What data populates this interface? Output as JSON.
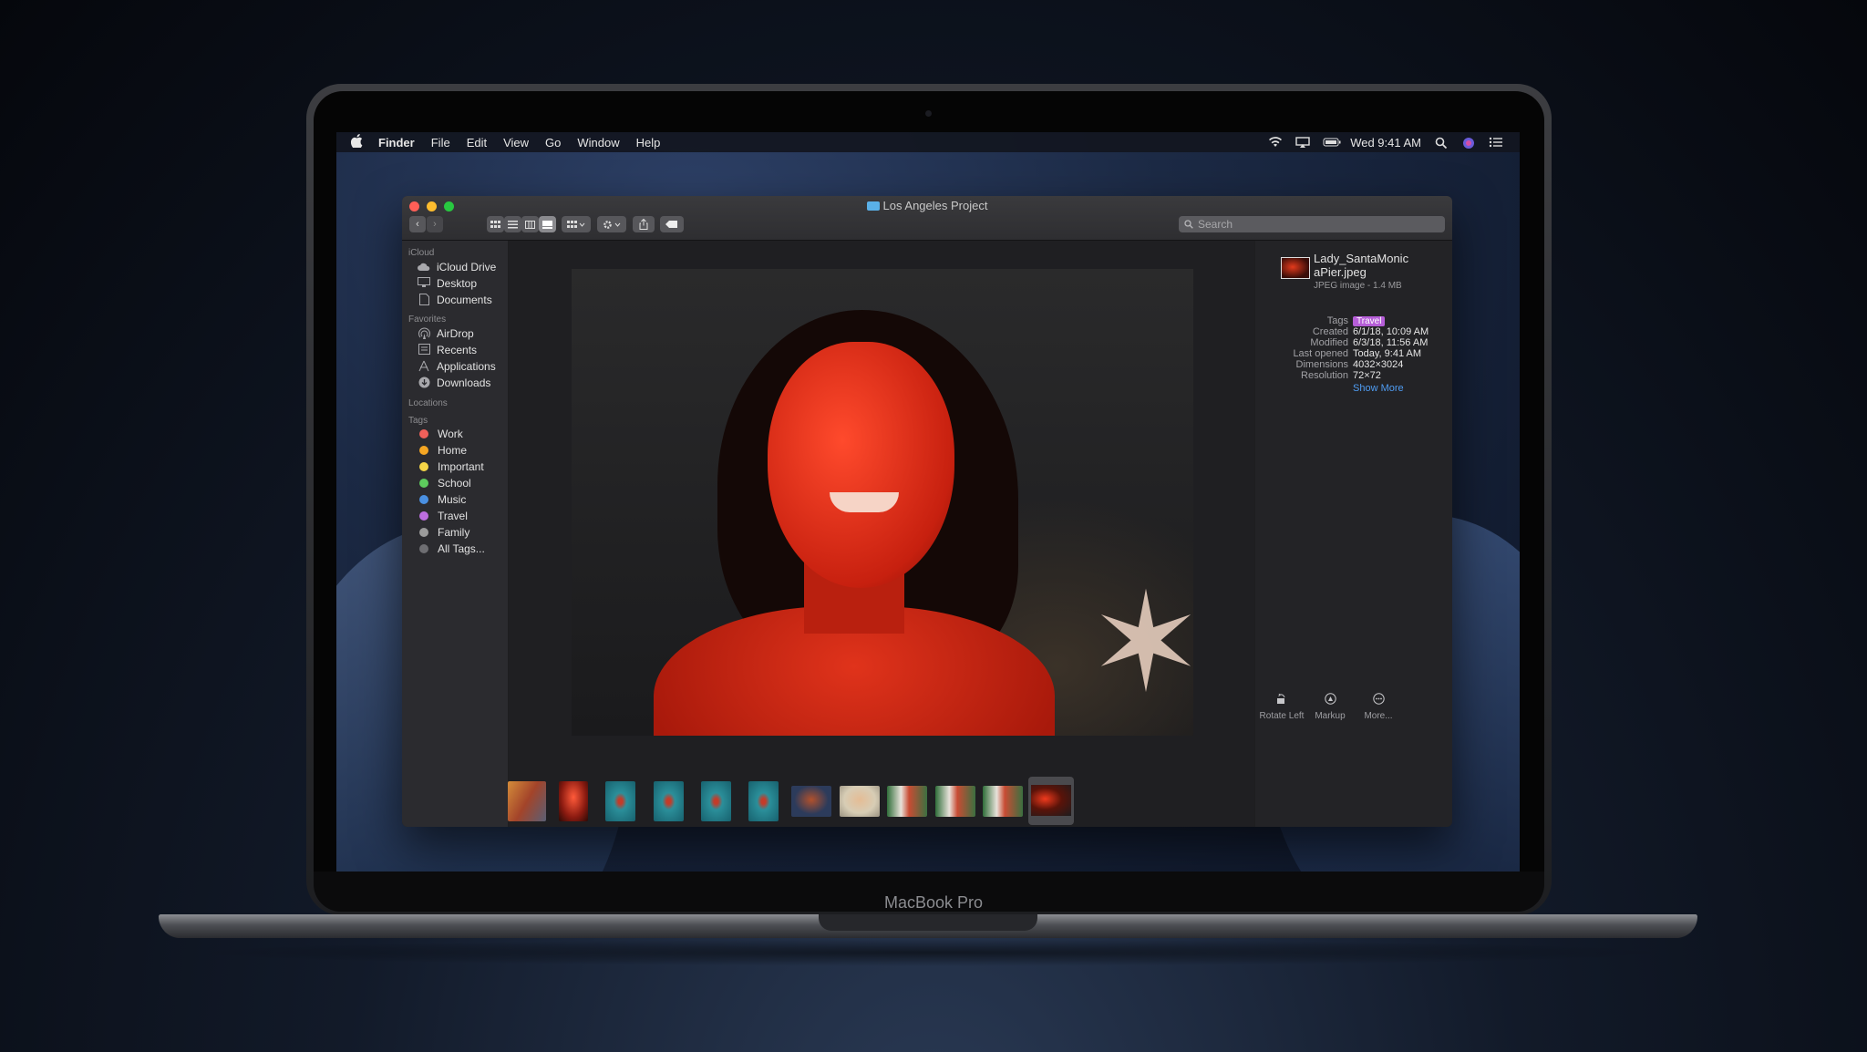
{
  "laptop": {
    "label": "MacBook Pro"
  },
  "menubar": {
    "app": "Finder",
    "items": [
      "File",
      "Edit",
      "View",
      "Go",
      "Window",
      "Help"
    ],
    "clock": "Wed 9:41 AM",
    "icons": [
      "apple-icon",
      "wifi-icon",
      "airplay-icon",
      "battery-icon",
      "spotlight-icon",
      "siri-icon",
      "notification-center-icon"
    ]
  },
  "window": {
    "title": "Los Angeles Project",
    "search_placeholder": "Search",
    "traffic_light_colors": [
      "#fe5f57",
      "#febc2e",
      "#28c840"
    ]
  },
  "sidebar": {
    "sections": [
      {
        "title": "iCloud",
        "items": [
          {
            "label": "iCloud Drive",
            "icon": "cloud-icon"
          },
          {
            "label": "Desktop",
            "icon": "desktop-icon"
          },
          {
            "label": "Documents",
            "icon": "document-icon"
          }
        ]
      },
      {
        "title": "Favorites",
        "items": [
          {
            "label": "AirDrop",
            "icon": "airdrop-icon"
          },
          {
            "label": "Recents",
            "icon": "clock-icon"
          },
          {
            "label": "Applications",
            "icon": "applications-icon"
          },
          {
            "label": "Downloads",
            "icon": "download-icon"
          }
        ]
      },
      {
        "title": "Locations",
        "items": []
      },
      {
        "title": "Tags",
        "items": [
          {
            "label": "Work",
            "color": "#f0605a"
          },
          {
            "label": "Home",
            "color": "#f5a623"
          },
          {
            "label": "Important",
            "color": "#f5d547"
          },
          {
            "label": "School",
            "color": "#5dcb5d"
          },
          {
            "label": "Music",
            "color": "#4a90e2"
          },
          {
            "label": "Travel",
            "color": "#bd6ee0"
          },
          {
            "label": "Family",
            "color": "#9b9b9b"
          },
          {
            "label": "All Tags...",
            "color": "#6e6e72"
          }
        ]
      }
    ]
  },
  "inspector": {
    "file_name": "Lady_SantaMonicaPier.jpeg",
    "file_name_line1": "Lady_SantaMonic",
    "file_name_line2": "aPier.jpeg",
    "file_info": "JPEG image - 1.4 MB",
    "tags_label": "Tags",
    "tag_value": "Travel",
    "tag_color": "#b65ed8",
    "metadata": [
      {
        "key": "Created",
        "value": "6/1/18, 10:09 AM"
      },
      {
        "key": "Modified",
        "value": "6/3/18, 11:56 AM"
      },
      {
        "key": "Last opened",
        "value": "Today, 9:41 AM"
      },
      {
        "key": "Dimensions",
        "value": "4032×3024"
      },
      {
        "key": "Resolution",
        "value": "72×72"
      }
    ],
    "show_more": "Show More",
    "actions": [
      {
        "label": "Rotate Left",
        "icon": "rotate-left-icon"
      },
      {
        "label": "Markup",
        "icon": "markup-icon"
      },
      {
        "label": "More...",
        "icon": "more-icon"
      }
    ]
  }
}
